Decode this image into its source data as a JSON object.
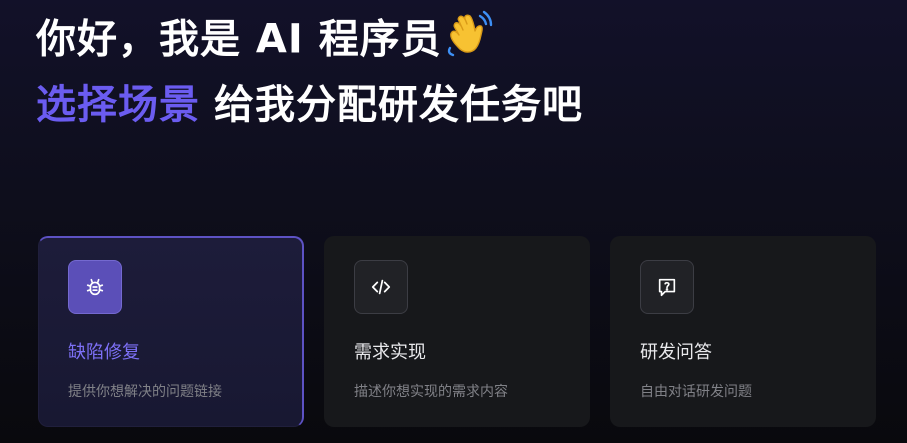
{
  "hero": {
    "greeting": "你好，我是 AI 程序员",
    "greeting_emoji": "waving-hand-icon",
    "accent": "选择场景",
    "subtitle": "给我分配研发任务吧"
  },
  "colors": {
    "accent": "#6b5cf0",
    "card_bg": "#17181b",
    "selected_card_bg": "#1d1c3a",
    "selected_border": "#5d52c4"
  },
  "cards": [
    {
      "title": "缺陷修复",
      "desc": "提供你想解决的问题链接",
      "icon": "bug-icon",
      "selected": true
    },
    {
      "title": "需求实现",
      "desc": "描述你想实现的需求内容",
      "icon": "code-icon",
      "selected": false
    },
    {
      "title": "研发问答",
      "desc": "自由对话研发问题",
      "icon": "question-chat-icon",
      "selected": false
    }
  ]
}
